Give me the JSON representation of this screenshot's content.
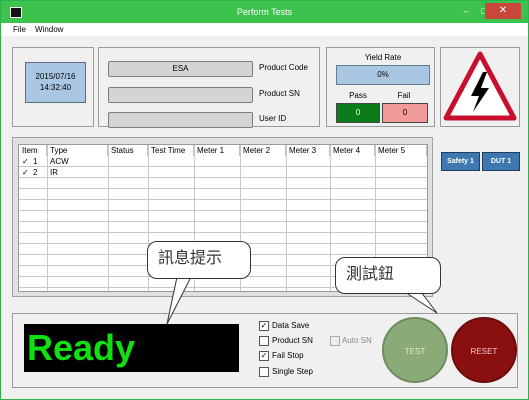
{
  "window": {
    "title": "Perform Tests",
    "close_label": "✕",
    "minimize_label": "–",
    "maximize_label": "□"
  },
  "menu": {
    "items": [
      "File",
      "Window"
    ]
  },
  "datetime": {
    "date": "2015/07/16",
    "time": "14:32:40"
  },
  "fields": [
    {
      "label": "Product Code",
      "value": "ESA"
    },
    {
      "label": "Product SN",
      "value": ""
    },
    {
      "label": "User ID",
      "value": ""
    }
  ],
  "yield": {
    "label": "Yield Rate",
    "value": "0%"
  },
  "pass": {
    "label": "Pass",
    "value": "0"
  },
  "fail": {
    "label": "Fail",
    "value": "0"
  },
  "table": {
    "columns": [
      "Item",
      "Type",
      "Status",
      "Test Time",
      "Meter 1",
      "Meter 2",
      "Meter 3",
      "Meter 4",
      "Meter 5"
    ],
    "rows": [
      {
        "check": "✓",
        "item": "1",
        "type": "ACW"
      },
      {
        "check": "✓",
        "item": "2",
        "type": "IR"
      }
    ]
  },
  "side_buttons": {
    "safety": "Safety 1",
    "dut": "DUT 1"
  },
  "status": {
    "text": "Ready"
  },
  "options": {
    "data_save": {
      "label": "Data Save",
      "checked": true
    },
    "product_sn": {
      "label": "Product SN",
      "checked": false
    },
    "auto_sn": {
      "label": "Auto SN",
      "checked": false
    },
    "fail_stop": {
      "label": "Fail Stop",
      "checked": true
    },
    "single_step": {
      "label": "Single Step",
      "checked": false
    }
  },
  "buttons": {
    "test": "TEST",
    "reset": "RESET"
  },
  "annotations": {
    "message_hint": "訊息提示",
    "test_button_hint": "測試鈕"
  },
  "colors": {
    "titlebar": "#3cc24d",
    "ready_text": "#10e010",
    "pass_bg": "#0a7c1a",
    "fail_bg": "#f29a9a",
    "test_btn": "#8aaa78",
    "reset_btn": "#8a1010"
  }
}
